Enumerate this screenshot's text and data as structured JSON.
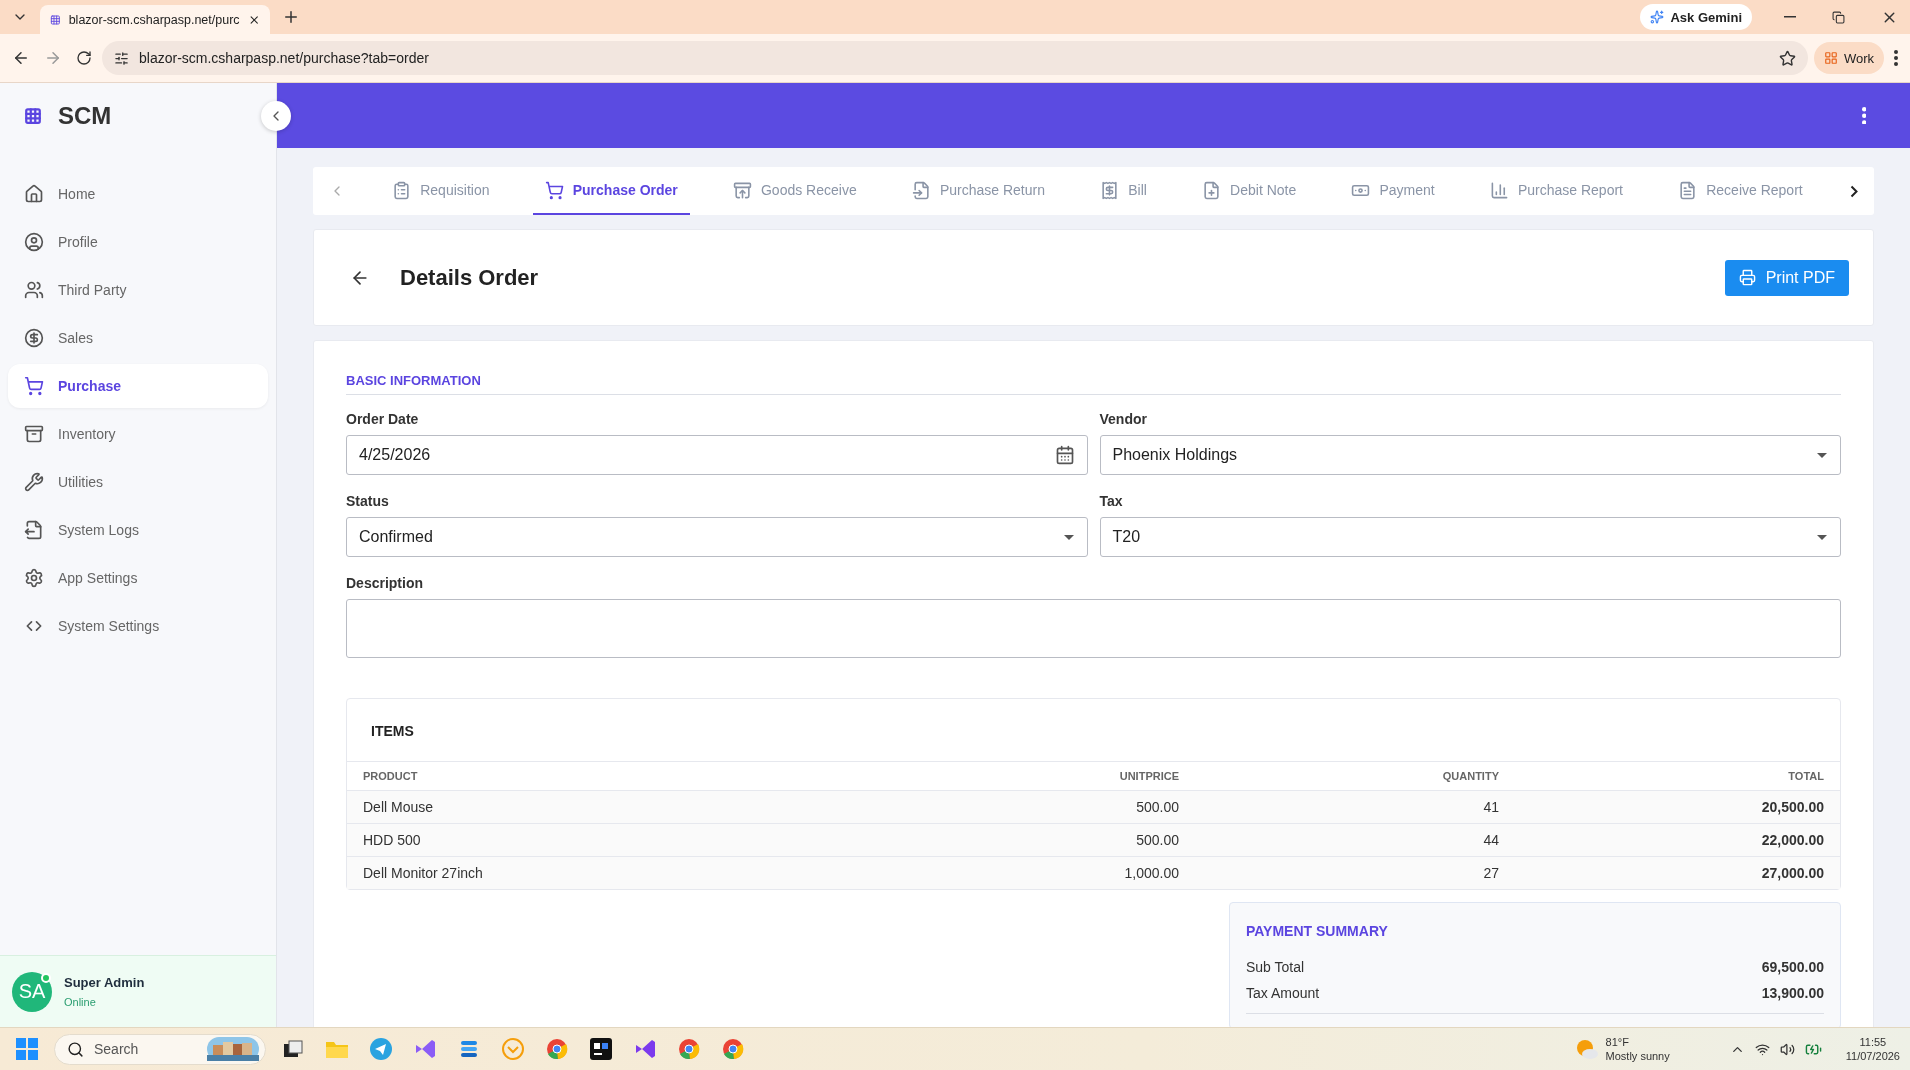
{
  "browser": {
    "tab_title": "blazor-scm.csharpasp.net/purc",
    "address": "blazor-scm.csharpasp.net/purchase?tab=order",
    "assistant_button": "Ask Gemini",
    "profile_button": "Work"
  },
  "sidebar": {
    "brand": "SCM",
    "items": [
      {
        "label": "Home",
        "selected": false
      },
      {
        "label": "Profile",
        "selected": false
      },
      {
        "label": "Third Party",
        "selected": false
      },
      {
        "label": "Sales",
        "selected": false
      },
      {
        "label": "Purchase",
        "selected": true
      },
      {
        "label": "Inventory",
        "selected": false
      },
      {
        "label": "Utilities",
        "selected": false
      },
      {
        "label": "System Logs",
        "selected": false
      },
      {
        "label": "App Settings",
        "selected": false
      },
      {
        "label": "System Settings",
        "selected": false
      }
    ],
    "user": {
      "initials": "SA",
      "name": "Super Admin",
      "status": "Online",
      "online": true
    }
  },
  "tabs": [
    {
      "label": "Requisition",
      "selected": false
    },
    {
      "label": "Purchase Order",
      "selected": true
    },
    {
      "label": "Goods Receive",
      "selected": false
    },
    {
      "label": "Purchase Return",
      "selected": false
    },
    {
      "label": "Bill",
      "selected": false
    },
    {
      "label": "Debit Note",
      "selected": false
    },
    {
      "label": "Payment",
      "selected": false
    },
    {
      "label": "Purchase Report",
      "selected": false
    },
    {
      "label": "Receive Report",
      "selected": false
    }
  ],
  "details": {
    "title": "Details Order",
    "print_button": "Print PDF"
  },
  "basic_information": {
    "title": "BASIC INFORMATION",
    "fields": [
      {
        "label": "Order Date",
        "kind": "date",
        "value": "4/25/2026"
      },
      {
        "label": "Vendor",
        "kind": "select",
        "value": "Phoenix Holdings"
      },
      {
        "label": "Status",
        "kind": "select",
        "value": "Confirmed"
      },
      {
        "label": "Tax",
        "kind": "select",
        "value": "T20"
      },
      {
        "label": "Description",
        "kind": "textarea"
      }
    ]
  },
  "items": {
    "title": "ITEMS",
    "columns": [
      "PRODUCT",
      "UNITPRICE",
      "QUANTITY",
      "TOTAL"
    ],
    "rows": [
      [
        "Dell Mouse",
        "500.00",
        "41",
        "20,500.00"
      ],
      [
        "HDD 500",
        "500.00",
        "44",
        "22,000.00"
      ],
      [
        "Dell Monitor 27inch",
        "1,000.00",
        "27",
        "27,000.00"
      ]
    ]
  },
  "payment_summary": {
    "title": "PAYMENT SUMMARY",
    "rows": [
      {
        "label": "Sub Total",
        "value": "69,500.00"
      },
      {
        "label": "Tax Amount",
        "value": "13,900.00"
      }
    ]
  },
  "taskbar": {
    "search_placeholder": "Search",
    "weather": {
      "temperature": "81°F",
      "condition": "Mostly sunny"
    },
    "time": "11:55",
    "date": "11/07/2026"
  }
}
